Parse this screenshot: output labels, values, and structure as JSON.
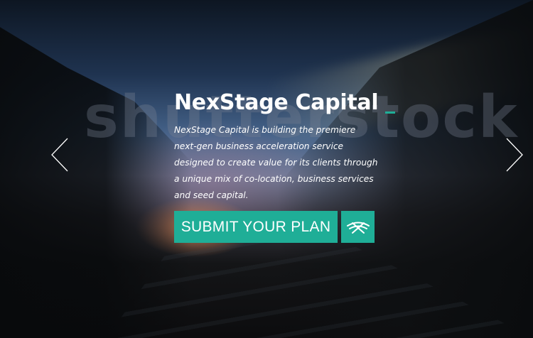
{
  "hero": {
    "title": "NexStage Capital",
    "description": "NexStage Capital is building the premiere next-gen business acceleration service designed to create value for its clients through a unique mix of co-location, business services and seed capital.",
    "cta_label": "SUBMIT YOUR PLAN",
    "watermark": "shutterstock",
    "accent_color": "#1fae97"
  },
  "icons": {
    "prev": "chevron-left-icon",
    "next": "chevron-right-icon",
    "logo": "nexstage-logo-icon"
  }
}
